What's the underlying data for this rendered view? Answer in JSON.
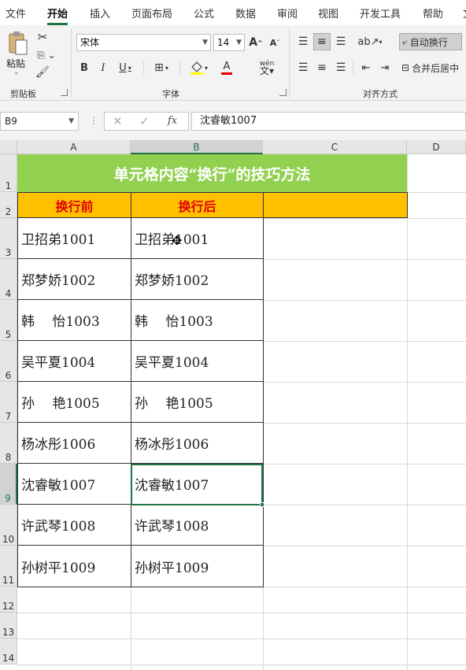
{
  "tabs": [
    "文件",
    "开始",
    "插入",
    "页面布局",
    "公式",
    "数据",
    "审阅",
    "视图",
    "开发工具",
    "帮助",
    "文"
  ],
  "active_tab": "开始",
  "ribbon": {
    "clipboard": {
      "paste_label": "粘贴",
      "group_label": "剪贴板"
    },
    "font": {
      "name": "宋体",
      "size": "14",
      "group_label": "字体",
      "bold": "B",
      "italic": "I",
      "underline": "U",
      "grow": "A",
      "shrink": "A",
      "color_a": "A",
      "phonetic": "wén"
    },
    "alignment": {
      "wrap_text": "自动换行",
      "merge_center": "合并后居中",
      "group_label": "对齐方式"
    }
  },
  "formula_bar": {
    "name_box": "B9",
    "fx": "fx",
    "content": "沈睿敏1007"
  },
  "columns": [
    "A",
    "B",
    "C",
    "D"
  ],
  "rows": [
    "1",
    "2",
    "3",
    "4",
    "5",
    "6",
    "7",
    "8",
    "9",
    "10",
    "11",
    "12",
    "13",
    "14"
  ],
  "sheet": {
    "title": "单元格内容“换行”的技巧方法",
    "headers": [
      "换行前",
      "换行后"
    ],
    "data": [
      [
        "卫招弟1001",
        "卫招弟1001"
      ],
      [
        "郑梦娇1002",
        "郑梦娇1002"
      ],
      [
        "韩　 怡1003",
        "韩　 怡1003"
      ],
      [
        "吴平夏1004",
        "吴平夏1004"
      ],
      [
        "孙　 艳1005",
        "孙　 艳1005"
      ],
      [
        "杨冰彤1006",
        "杨冰彤1006"
      ],
      [
        "沈睿敏1007",
        "沈睿敏1007"
      ],
      [
        "许武琴1008",
        "许武琴1008"
      ],
      [
        "孙树平1009",
        "孙树平1009"
      ]
    ]
  },
  "selected_cell": "B9",
  "colors": {
    "title_bg": "#92d050",
    "header_bg": "#ffc000",
    "header_text": "#e00000",
    "accent": "#217346"
  }
}
